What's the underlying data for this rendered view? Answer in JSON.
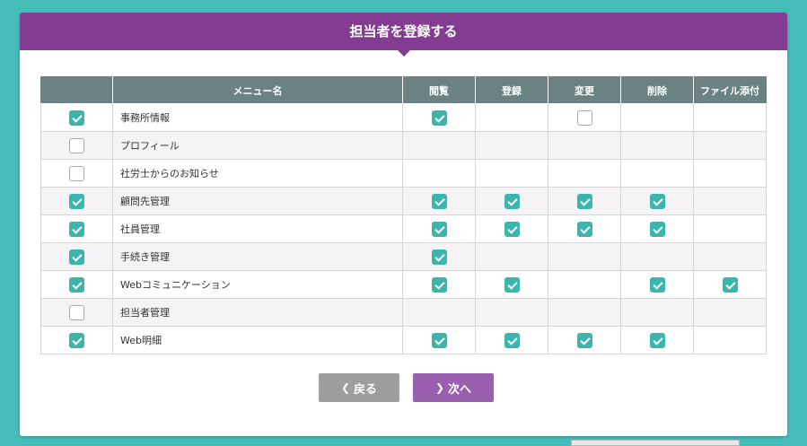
{
  "header": {
    "title": "担当者を登録する"
  },
  "table": {
    "columns": [
      "",
      "メニュー名",
      "閲覧",
      "登録",
      "変更",
      "削除",
      "ファイル添付"
    ],
    "rows": [
      {
        "enabled": true,
        "name": "事務所情報",
        "perms": [
          "on",
          null,
          "off",
          null,
          null
        ]
      },
      {
        "enabled": false,
        "name": "プロフィール",
        "perms": [
          null,
          null,
          null,
          null,
          null
        ]
      },
      {
        "enabled": false,
        "name": "社労士からのお知らせ",
        "perms": [
          null,
          null,
          null,
          null,
          null
        ]
      },
      {
        "enabled": true,
        "name": "顧問先管理",
        "perms": [
          "on",
          "on",
          "on",
          "on",
          null
        ]
      },
      {
        "enabled": true,
        "name": "社員管理",
        "perms": [
          "on",
          "on",
          "on",
          "on",
          null
        ]
      },
      {
        "enabled": true,
        "name": "手続き管理",
        "perms": [
          "on",
          null,
          null,
          null,
          null
        ]
      },
      {
        "enabled": true,
        "name": "Webコミュニケーション",
        "perms": [
          "on",
          "on",
          null,
          "on",
          "on"
        ]
      },
      {
        "enabled": false,
        "name": "担当者管理",
        "perms": [
          null,
          null,
          null,
          null,
          null
        ]
      },
      {
        "enabled": true,
        "name": "Web明細",
        "perms": [
          "on",
          "on",
          "on",
          "on",
          null
        ]
      }
    ]
  },
  "buttons": {
    "back_label": "戻る",
    "next_label": "次へ"
  },
  "colors": {
    "header": "#843c92",
    "checkbox_on": "#3cb5ac",
    "table_head": "#6a8282",
    "background": "#44bdb9"
  }
}
